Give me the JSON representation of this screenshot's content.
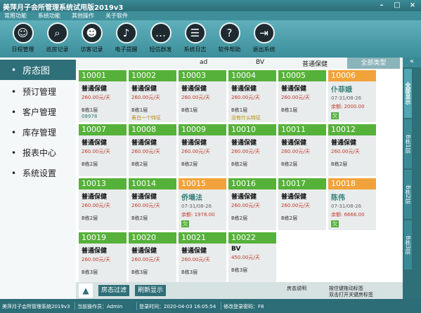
{
  "window": {
    "title": "美萍月子会所管理系统试用版2019v3",
    "min": "–",
    "max": "□",
    "close": "×"
  },
  "menu": [
    "常用功能",
    "系统功能",
    "其他操作",
    "关于软件"
  ],
  "toolbar": [
    {
      "label": "日程管理",
      "icon": "person-icon",
      "glyph": "☺"
    },
    {
      "label": "巡房记录",
      "icon": "search-icon",
      "glyph": "⌕"
    },
    {
      "label": "访客记录",
      "icon": "visitor-icon",
      "glyph": "☻"
    },
    {
      "label": "电子提醒",
      "icon": "bell-icon",
      "glyph": "♪"
    },
    {
      "label": "短信群发",
      "icon": "chat-icon",
      "glyph": "…"
    },
    {
      "label": "系统日志",
      "icon": "log-icon",
      "glyph": "☰"
    },
    {
      "label": "软件帮助",
      "icon": "help-icon",
      "glyph": "?"
    },
    {
      "label": "退出系统",
      "icon": "exit-icon",
      "glyph": "⇥"
    }
  ],
  "nav": [
    "房态图",
    "预订管理",
    "客户管理",
    "库存管理",
    "报表中心",
    "系统设置"
  ],
  "filter": {
    "c1": "ad",
    "c2": "BV",
    "c3": "普通保健",
    "all": "全部类型"
  },
  "rooms": [
    {
      "num": "10001",
      "type": "普通保健",
      "price": "260.00元/天",
      "floor": "B栋1层",
      "note": "08978"
    },
    {
      "num": "10002",
      "type": "普通保健",
      "price": "260.00元/天",
      "floor": "B栋1层",
      "remark": "表白一个特征"
    },
    {
      "num": "10003",
      "type": "普通保健",
      "price": "260.00元/天",
      "floor": "B栋1层"
    },
    {
      "num": "10004",
      "type": "普通保健",
      "price": "260.00元/天",
      "floor": "B栋1层",
      "remark": "没有什么特征"
    },
    {
      "num": "10005",
      "type": "普通保健",
      "price": "260.00元/天",
      "floor": "B栋1层"
    },
    {
      "num": "10006",
      "status": "occupied",
      "name": "仆菲娥",
      "date": "07-31/08-26",
      "balance": "余额: 2000.00",
      "tag": "欠"
    },
    {
      "num": "10007",
      "type": "普通保健",
      "price": "260.00元/天",
      "floor": "B栋2层"
    },
    {
      "num": "10008",
      "type": "普通保健",
      "price": "260.00元/天",
      "floor": "B栋2层"
    },
    {
      "num": "10009",
      "type": "普通保健",
      "price": "260.00元/天",
      "floor": "B栋2层"
    },
    {
      "num": "10010",
      "type": "普通保健",
      "price": "260.00元/天",
      "floor": "B栋2层"
    },
    {
      "num": "10011",
      "type": "普通保健",
      "price": "260.00元/天",
      "floor": "B栋2层"
    },
    {
      "num": "10012",
      "type": "普通保健",
      "price": "260.00元/天",
      "floor": "B栋2层"
    },
    {
      "num": "10013",
      "type": "普通保健",
      "price": "260.00元/天",
      "floor": "B栋2层"
    },
    {
      "num": "10014",
      "type": "普通保健",
      "price": "260.00元/天",
      "floor": "B栋2层"
    },
    {
      "num": "10015",
      "status": "occupied",
      "name": "侨塌法",
      "date": "07-31/08-26",
      "balance": "余额: 1978.00",
      "tag": "欠"
    },
    {
      "num": "10016",
      "type": "普通保健",
      "price": "260.00元/天",
      "floor": "B栋2层"
    },
    {
      "num": "10017",
      "type": "普通保健",
      "price": "260.00元/天",
      "floor": "B栋2层"
    },
    {
      "num": "10018",
      "status": "occupied",
      "name": "陈伟",
      "date": "07-31/08-26",
      "balance": "余额: 6666.00",
      "tag": "欠"
    },
    {
      "num": "10019",
      "type": "普通保健",
      "price": "260.00元/天",
      "floor": "B栋3层"
    },
    {
      "num": "10020",
      "type": "普通保健",
      "price": "260.00元/天",
      "floor": "B栋3层"
    },
    {
      "num": "10021",
      "type": "普通保健",
      "price": "260.00元/天",
      "floor": "B栋3层"
    },
    {
      "num": "10022",
      "type": "BV",
      "price": "450.00元/天",
      "floor": "B栋3层"
    }
  ],
  "actionbar": {
    "up": "▲",
    "filter": "房态过滤",
    "refresh": "刷新显示",
    "legend1": "房态说明",
    "legend2": "按住键拖动标签",
    "legend3": "双击打开关键房标签"
  },
  "righttabs": [
    "全部显示",
    "B栋1层",
    "B栋2层",
    "B栋3层"
  ],
  "collapse": "«",
  "status": {
    "app": "美萍月子会所管理系统2019v3",
    "operator": "当前操作员：Admin",
    "login": "登录时间：2020-04-03 16:05:54",
    "shortcut": "修改登录密码：F8"
  }
}
